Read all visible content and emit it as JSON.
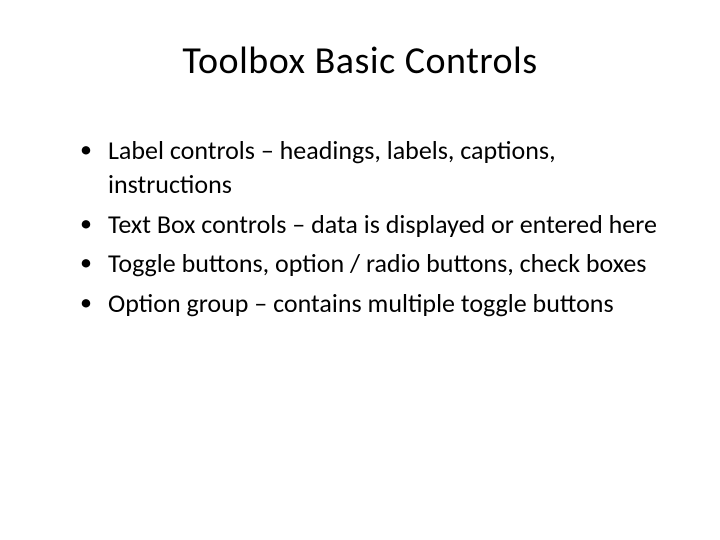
{
  "title": "Toolbox Basic Controls",
  "bullets": [
    "Label controls – headings, labels, captions, instructions",
    "Text Box controls – data is displayed or entered here",
    "Toggle buttons, option / radio buttons, check boxes",
    "Option group – contains multiple toggle buttons"
  ]
}
